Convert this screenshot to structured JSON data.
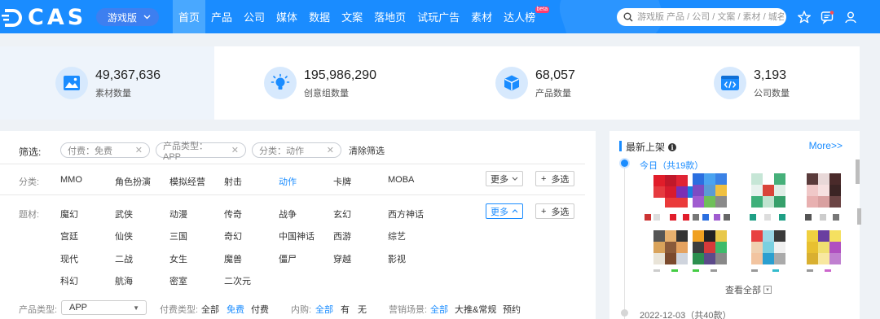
{
  "header": {
    "logo_text": "CAS",
    "edition_label": "游戏版",
    "nav": [
      {
        "label": "首页",
        "active": true
      },
      {
        "label": "产品"
      },
      {
        "label": "公司"
      },
      {
        "label": "媒体"
      },
      {
        "label": "数据"
      },
      {
        "label": "文案"
      },
      {
        "label": "落地页"
      },
      {
        "label": "试玩广告"
      },
      {
        "label": "素材"
      },
      {
        "label": "达人榜",
        "badge": "beta"
      }
    ],
    "search_placeholder": "游戏版 产品 / 公司 / 文案 / 素材 / 城名",
    "icons": [
      "star-icon",
      "message-icon",
      "user-icon"
    ],
    "colors": {
      "brand": "#1a8cff",
      "active_tab": "#49a8ff"
    }
  },
  "stats": [
    {
      "value": "49,367,636",
      "label": "素材数量",
      "icon": "image-icon"
    },
    {
      "value": "195,986,290",
      "label": "创意组数量",
      "icon": "lightbulb-icon"
    },
    {
      "value": "68,057",
      "label": "产品数量",
      "icon": "cube-icon"
    },
    {
      "value": "3,193",
      "label": "公司数量",
      "icon": "code-window-icon"
    }
  ],
  "filters": {
    "active_label": "筛选:",
    "active_chips": [
      "付费：免费",
      "产品类型：APP",
      "分类：动作"
    ],
    "clear_label": "清除筛选",
    "category": {
      "label": "分类:",
      "options": [
        "MMO",
        "角色扮演",
        "模拟经营",
        "射击",
        "动作",
        "卡牌",
        "MOBA"
      ],
      "selected": "动作",
      "more_label": "更多",
      "multi_label": "多选"
    },
    "theme": {
      "label": "题材:",
      "rows": [
        [
          "魔幻",
          "武侠",
          "动漫",
          "传奇",
          "战争",
          "玄幻",
          "西方神话"
        ],
        [
          "宫廷",
          "仙侠",
          "三国",
          "奇幻",
          "中国神话",
          "西游",
          "综艺"
        ],
        [
          "现代",
          "二战",
          "女生",
          "魔兽",
          "僵尸",
          "穿越",
          "影视"
        ],
        [
          "科幻",
          "航海",
          "密室",
          "二次元"
        ]
      ],
      "more_label": "更多",
      "multi_label": "多选"
    },
    "bottom": {
      "product_type_label": "产品类型:",
      "product_type_value": "APP",
      "pay_type_label": "付费类型:",
      "pay_type_options": [
        "全部",
        "免费",
        "付费"
      ],
      "pay_type_selected": "免费",
      "iap_label": "内购:",
      "iap_options": [
        "全部",
        "有",
        "无"
      ],
      "iap_selected": "全部",
      "scene_label": "营销场景:",
      "scene_options": [
        "全部",
        "大推&常规",
        "预约"
      ],
      "scene_selected": "全部"
    }
  },
  "latest": {
    "title": "最新上架",
    "more_label": "More>>",
    "today_label": "今日（共19款）",
    "view_all_label": "查看全部",
    "next_date_label": "2022-12-03（共40款）"
  }
}
